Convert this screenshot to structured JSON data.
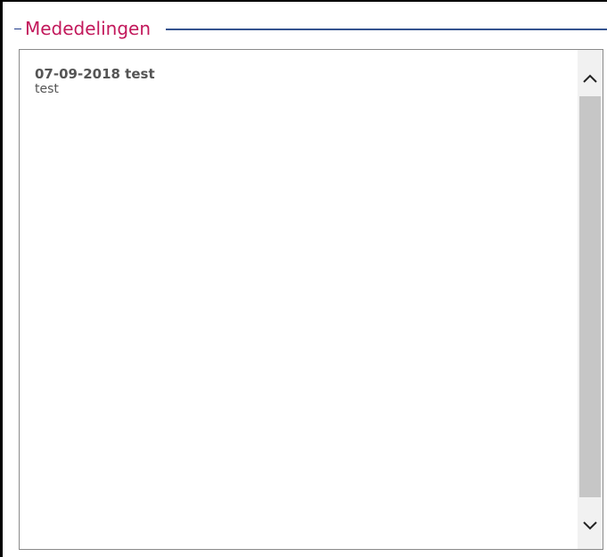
{
  "section": {
    "title": "Mededelingen"
  },
  "announcements": [
    {
      "title": "07-09-2018 test",
      "body": "test"
    }
  ],
  "scrollbar": {
    "up_icon": "chevron-up-icon",
    "down_icon": "chevron-down-icon"
  },
  "colors": {
    "title": "#c2185b",
    "rule": "#34538f",
    "text": "#555555",
    "panel_border": "#8a8a8a",
    "thumb": "#c6c6c6"
  }
}
